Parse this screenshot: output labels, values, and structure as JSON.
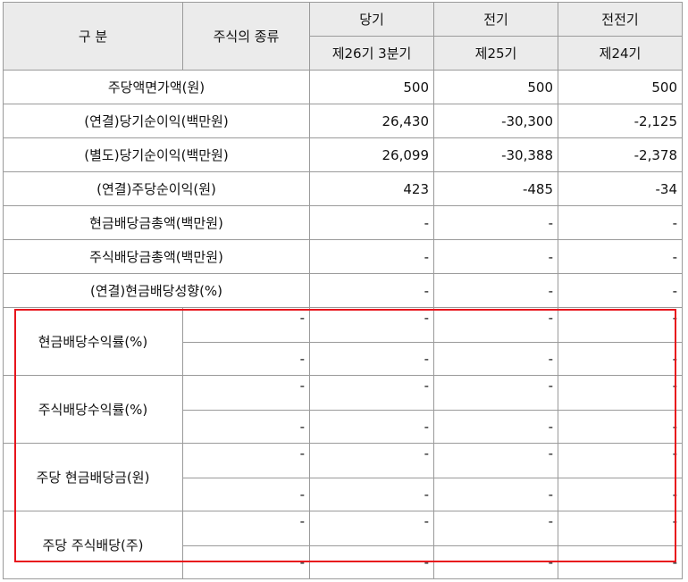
{
  "header": {
    "category": "구  분",
    "stock_type": "주식의 종류",
    "current": "당기",
    "prior": "전기",
    "prior2": "전전기",
    "current_period": "제26기 3분기",
    "prior_period": "제25기",
    "prior2_period": "제24기"
  },
  "rows": [
    {
      "label": "주당액면가액(원)",
      "values": [
        "500",
        "500",
        "500"
      ]
    },
    {
      "label": "(연결)당기순이익(백만원)",
      "values": [
        "26,430",
        "-30,300",
        "-2,125"
      ]
    },
    {
      "label": "(별도)당기순이익(백만원)",
      "values": [
        "26,099",
        "-30,388",
        "-2,378"
      ]
    },
    {
      "label": "(연결)주당순이익(원)",
      "values": [
        "423",
        "-485",
        "-34"
      ]
    },
    {
      "label": "현금배당금총액(백만원)",
      "values": [
        "-",
        "-",
        "-"
      ]
    },
    {
      "label": "주식배당금총액(백만원)",
      "values": [
        "-",
        "-",
        "-"
      ]
    },
    {
      "label": "(연결)현금배당성향(%)",
      "values": [
        "-",
        "-",
        "-"
      ]
    }
  ],
  "split_rows": [
    {
      "label": "현금배당수익률(%)",
      "sub": [
        [
          "-",
          "-",
          "-",
          "-"
        ],
        [
          "-",
          "-",
          "-",
          "-"
        ]
      ]
    },
    {
      "label": "주식배당수익률(%)",
      "sub": [
        [
          "-",
          "-",
          "-",
          "-"
        ],
        [
          "-",
          "-",
          "-",
          "-"
        ]
      ]
    },
    {
      "label": "주당 현금배당금(원)",
      "sub": [
        [
          "-",
          "-",
          "-",
          "-"
        ],
        [
          "-",
          "-",
          "-",
          "-"
        ]
      ]
    },
    {
      "label": "주당 주식배당(주)",
      "sub": [
        [
          "-",
          "-",
          "-",
          "-"
        ],
        [
          "-",
          "-",
          "-",
          "-"
        ]
      ]
    }
  ],
  "highlight_color": "#e8141c"
}
